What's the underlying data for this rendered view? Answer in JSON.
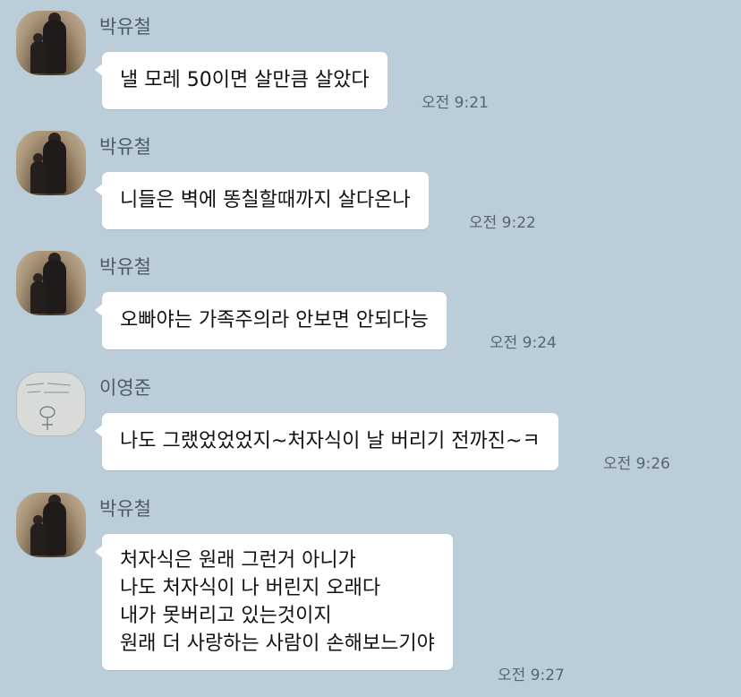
{
  "chat": {
    "messages": [
      {
        "sender": "박유철",
        "avatar": "photo-avatar",
        "lines": [
          "낼 모레 50이면 살만큼 살았다"
        ],
        "time": "오전 9:21"
      },
      {
        "sender": "박유철",
        "avatar": "photo-avatar",
        "lines": [
          "니들은 벽에 똥칠할때까지 살다온나"
        ],
        "time": "오전 9:22"
      },
      {
        "sender": "박유철",
        "avatar": "photo-avatar",
        "lines": [
          "오빠야는 가족주의라 안보면 안되다능"
        ],
        "time": "오전 9:24"
      },
      {
        "sender": "이영준",
        "avatar": "sketch-avatar",
        "lines": [
          "나도 그랬었었었지~처자식이 날 버리기 전까진~ㅋ"
        ],
        "time": "오전 9:26"
      },
      {
        "sender": "박유철",
        "avatar": "photo-avatar",
        "lines": [
          "처자식은 원래 그런거 아니가",
          "나도 처자식이 나 버린지 오래다",
          "내가 못버리고 있는것이지",
          "원래 더 사랑하는 사람이 손해보느기야"
        ],
        "time": "오전 9:27"
      }
    ]
  }
}
